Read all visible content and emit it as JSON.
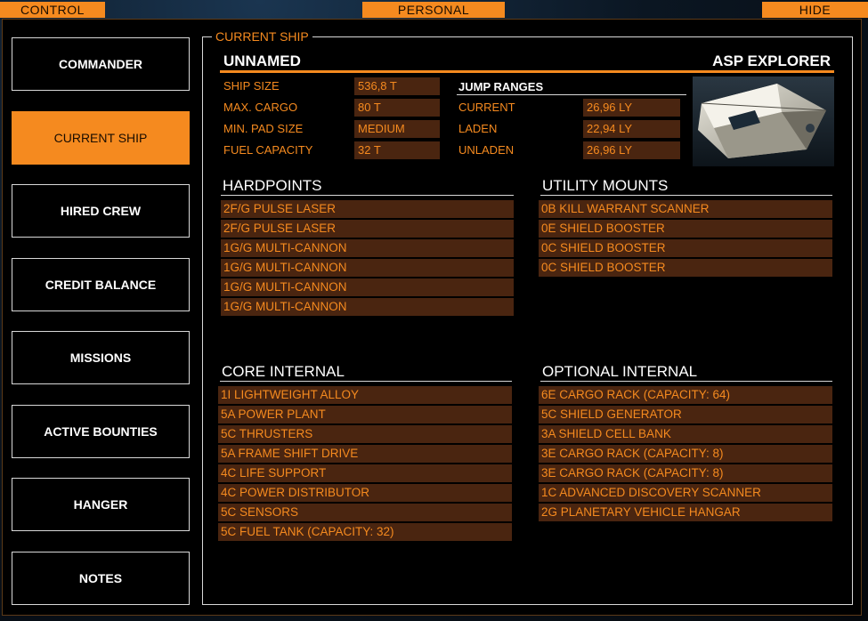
{
  "topbar": {
    "control": "CONTROL",
    "personal": "PERSONAL",
    "hide": "HIDE"
  },
  "nav": [
    "COMMANDER",
    "CURRENT SHIP",
    "HIRED CREW",
    "CREDIT BALANCE",
    "MISSIONS",
    "ACTIVE BOUNTIES",
    "HANGER",
    "NOTES"
  ],
  "nav_active": "CURRENT SHIP",
  "panel_title": "CURRENT SHIP",
  "ship": {
    "name": "UNNAMED",
    "model": "ASP EXPLORER",
    "stats": [
      {
        "label": "SHIP SIZE",
        "value": "536,8 T"
      },
      {
        "label": "MAX. CARGO",
        "value": "80 T"
      },
      {
        "label": "MIN. PAD SIZE",
        "value": "MEDIUM"
      },
      {
        "label": "FUEL CAPACITY",
        "value": "32 T"
      }
    ],
    "jump_ranges_title": "JUMP RANGES",
    "jump_ranges": [
      {
        "label": "CURRENT",
        "value": "26,96 LY"
      },
      {
        "label": "LADEN",
        "value": "22,94 LY"
      },
      {
        "label": "UNLADEN",
        "value": "26,96 LY"
      }
    ]
  },
  "hardpoints": {
    "title": "HARDPOINTS",
    "items": [
      "2F/G PULSE LASER",
      "2F/G PULSE LASER",
      "1G/G MULTI-CANNON",
      "1G/G MULTI-CANNON",
      "1G/G MULTI-CANNON",
      "1G/G MULTI-CANNON"
    ]
  },
  "utility": {
    "title": "UTILITY MOUNTS",
    "items": [
      "0B KILL WARRANT SCANNER",
      "0E SHIELD BOOSTER",
      "0C SHIELD BOOSTER",
      "0C SHIELD BOOSTER"
    ]
  },
  "core": {
    "title": "CORE INTERNAL",
    "items": [
      "1I LIGHTWEIGHT ALLOY",
      "5A POWER PLANT",
      "5C THRUSTERS",
      "5A FRAME SHIFT DRIVE",
      "4C LIFE SUPPORT",
      "4C POWER DISTRIBUTOR",
      "5C SENSORS",
      "5C FUEL TANK (CAPACITY: 32)"
    ]
  },
  "optional": {
    "title": "OPTIONAL INTERNAL",
    "items": [
      "6E CARGO RACK (CAPACITY: 64)",
      "5C SHIELD GENERATOR",
      "3A SHIELD CELL BANK",
      "3E CARGO RACK (CAPACITY: 8)",
      "3E CARGO RACK (CAPACITY: 8)",
      "1C ADVANCED DISCOVERY SCANNER",
      "2G PLANETARY VEHICLE HANGAR"
    ]
  },
  "colors": {
    "accent": "#f58a1f",
    "cell_bg": "#4a2510",
    "border": "#d8d8d8"
  }
}
